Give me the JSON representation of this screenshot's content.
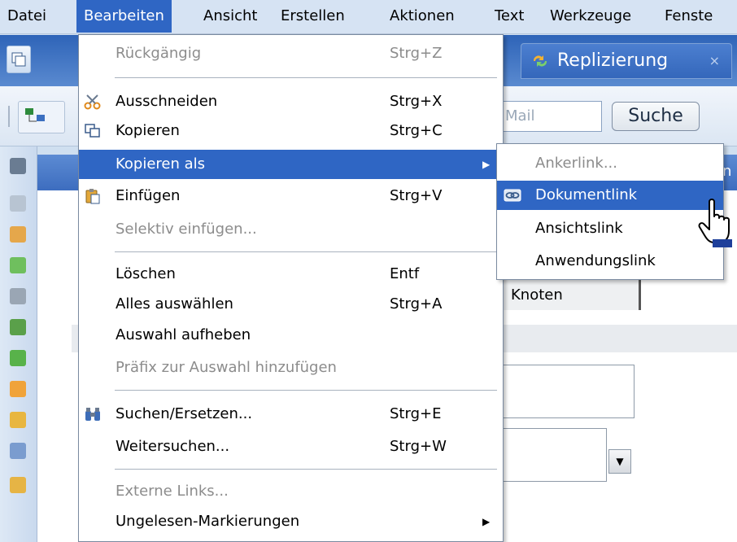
{
  "menubar": {
    "items": [
      {
        "label": "Datei"
      },
      {
        "label": "Bearbeiten"
      },
      {
        "label": "Ansicht"
      },
      {
        "label": "Erstellen"
      },
      {
        "label": "Aktionen"
      },
      {
        "label": "Text"
      },
      {
        "label": "Werkzeuge"
      },
      {
        "label": "Fenste"
      }
    ],
    "active_index": 1
  },
  "tabs": {
    "replication_label": "Replizierung",
    "close_glyph": "×"
  },
  "toolbar": {
    "mail_placeholder": "Mail",
    "search_label": "Suche"
  },
  "background": {
    "header_partial": "n",
    "column_header": "Knoten"
  },
  "edit_menu": {
    "items": [
      {
        "label": "Rückgängig",
        "shortcut": "Strg+Z",
        "enabled": false,
        "icon": ""
      },
      {
        "label": "Ausschneiden",
        "shortcut": "Strg+X",
        "enabled": true,
        "icon": "scissors-icon"
      },
      {
        "label": "Kopieren",
        "shortcut": "Strg+C",
        "enabled": true,
        "icon": "copy-icon"
      },
      {
        "label": "Kopieren als",
        "shortcut": "",
        "enabled": true,
        "icon": "",
        "submenu": true,
        "highlighted": true
      },
      {
        "label": "Einfügen",
        "shortcut": "Strg+V",
        "enabled": true,
        "icon": "paste-icon"
      },
      {
        "label": "Selektiv einfügen...",
        "shortcut": "",
        "enabled": false,
        "icon": ""
      },
      {
        "label": "Löschen",
        "shortcut": "Entf",
        "enabled": true,
        "icon": ""
      },
      {
        "label": "Alles auswählen",
        "shortcut": "Strg+A",
        "enabled": true,
        "icon": ""
      },
      {
        "label": "Auswahl aufheben",
        "shortcut": "",
        "enabled": true,
        "icon": ""
      },
      {
        "label": "Präfix zur Auswahl hinzufügen",
        "shortcut": "",
        "enabled": false,
        "icon": ""
      },
      {
        "label": "Suchen/Ersetzen...",
        "shortcut": "Strg+E",
        "enabled": true,
        "icon": "binoculars-icon"
      },
      {
        "label": "Weitersuchen...",
        "shortcut": "Strg+W",
        "enabled": true,
        "icon": ""
      },
      {
        "label": "Externe Links...",
        "shortcut": "",
        "enabled": false,
        "icon": ""
      },
      {
        "label": "Ungelesen-Markierungen",
        "shortcut": "",
        "enabled": true,
        "icon": "",
        "submenu": true
      }
    ]
  },
  "copy_as_submenu": {
    "items": [
      {
        "label": "Ankerlink...",
        "enabled": false
      },
      {
        "label": "Dokumentlink",
        "enabled": true,
        "highlighted": true,
        "icon": "link-icon"
      },
      {
        "label": "Ansichtslink",
        "enabled": true
      },
      {
        "label": "Anwendungslink",
        "enabled": true
      }
    ]
  },
  "colors": {
    "highlight": "#2f66c4",
    "menubar_bg": "#d6e3f3",
    "disabled_text": "#8c8c8c"
  }
}
